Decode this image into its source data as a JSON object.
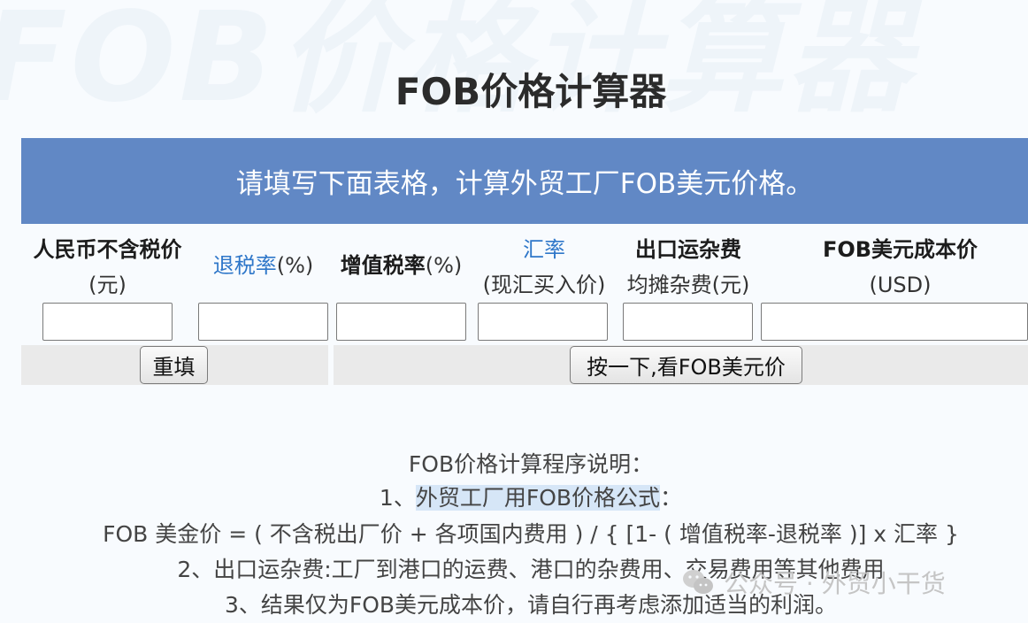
{
  "watermark_bg": "FOB价格计算器",
  "title": "FOB价格计算器",
  "banner": "请填写下面表格，计算外贸工厂FOB美元价格。",
  "columns": [
    {
      "line1": "人民币不含税价",
      "line2": "(元)"
    },
    {
      "line1_part1": "退税率",
      "line1_part2": "(%)"
    },
    {
      "line1_part1": "增值税率",
      "line1_part2": "(%)"
    },
    {
      "line1": "汇率",
      "line2": "(现汇买入价)"
    },
    {
      "line1": "出口运杂费",
      "line2": "均摊杂费(元)"
    },
    {
      "line1": "FOB美元成本价",
      "line2": "(USD)"
    }
  ],
  "inputs": [
    "",
    "",
    "",
    "",
    "",
    ""
  ],
  "buttons": {
    "reset": "重填",
    "calc": "按一下,看FOB美元价"
  },
  "notes": {
    "heading": "FOB价格计算程序说明：",
    "item1_prefix": "1、",
    "item1_text": "外贸工厂用FOB价格公式",
    "item1_suffix": "：",
    "formula": "FOB 美金价 = ( 不含税出厂价 + 各项国内费用 ) / { [1- ( 增值税率-退税率 )] x 汇率 }",
    "item2": "2、出口运杂费:工厂到港口的运费、港口的杂费用、交易费用等其他费用",
    "item3": "3、结果仅为FOB美元成本价，请自行再考虑添加适当的利润。"
  },
  "watermark": "公众号 · 外贸小干货",
  "colors": {
    "banner": "#6188c5",
    "link_blue": "#2f77c9",
    "highlight": "#d6e6f7"
  }
}
